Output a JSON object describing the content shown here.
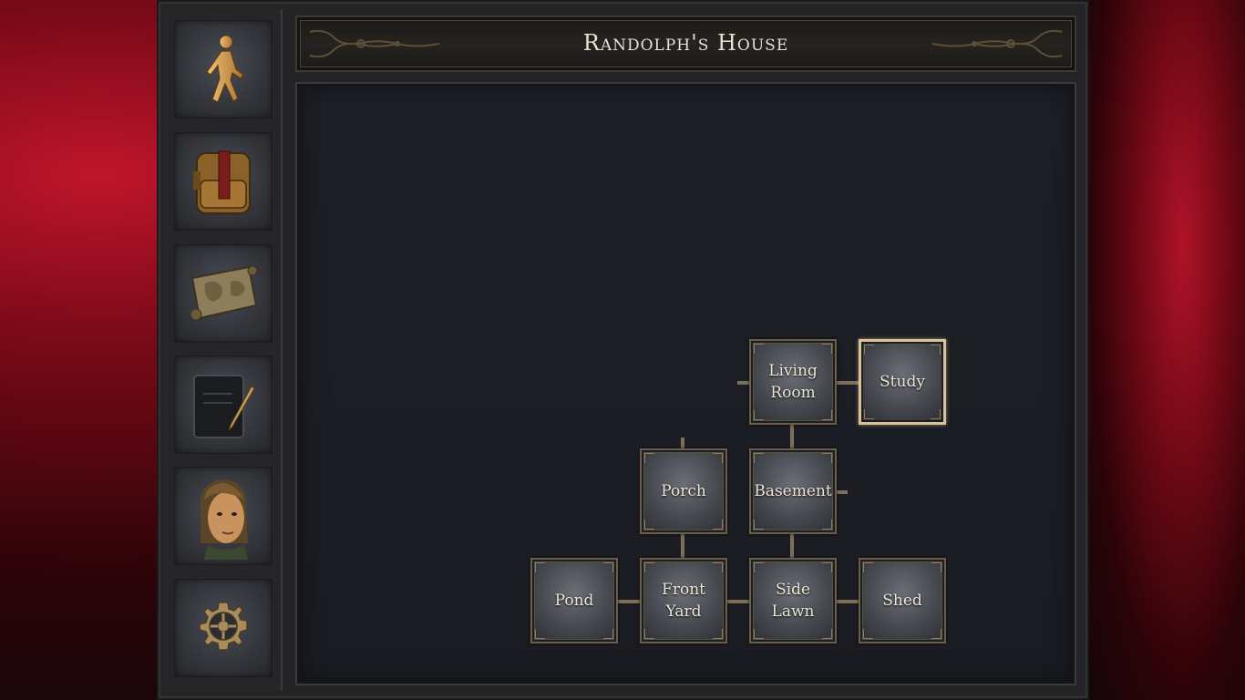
{
  "header": {
    "title": "Randolph's House"
  },
  "sidebar": {
    "items": [
      {
        "name": "walk-icon"
      },
      {
        "name": "backpack-icon"
      },
      {
        "name": "map-scroll-icon"
      },
      {
        "name": "journal-icon"
      },
      {
        "name": "character-portrait"
      },
      {
        "name": "gear-icon"
      }
    ]
  },
  "map": {
    "rooms": [
      {
        "id": "living-room",
        "label": "Living\nRoom",
        "current": false
      },
      {
        "id": "study",
        "label": "Study",
        "current": true
      },
      {
        "id": "porch",
        "label": "Porch",
        "current": false
      },
      {
        "id": "basement",
        "label": "Basement",
        "current": false
      },
      {
        "id": "pond",
        "label": "Pond",
        "current": false
      },
      {
        "id": "front-yard",
        "label": "Front\nYard",
        "current": false
      },
      {
        "id": "side-lawn",
        "label": "Side\nLawn",
        "current": false
      },
      {
        "id": "shed",
        "label": "Shed",
        "current": false
      }
    ]
  },
  "colors": {
    "accent_gold": "#d9c398",
    "connector": "#7c705a",
    "background_red": "#c0152b"
  }
}
